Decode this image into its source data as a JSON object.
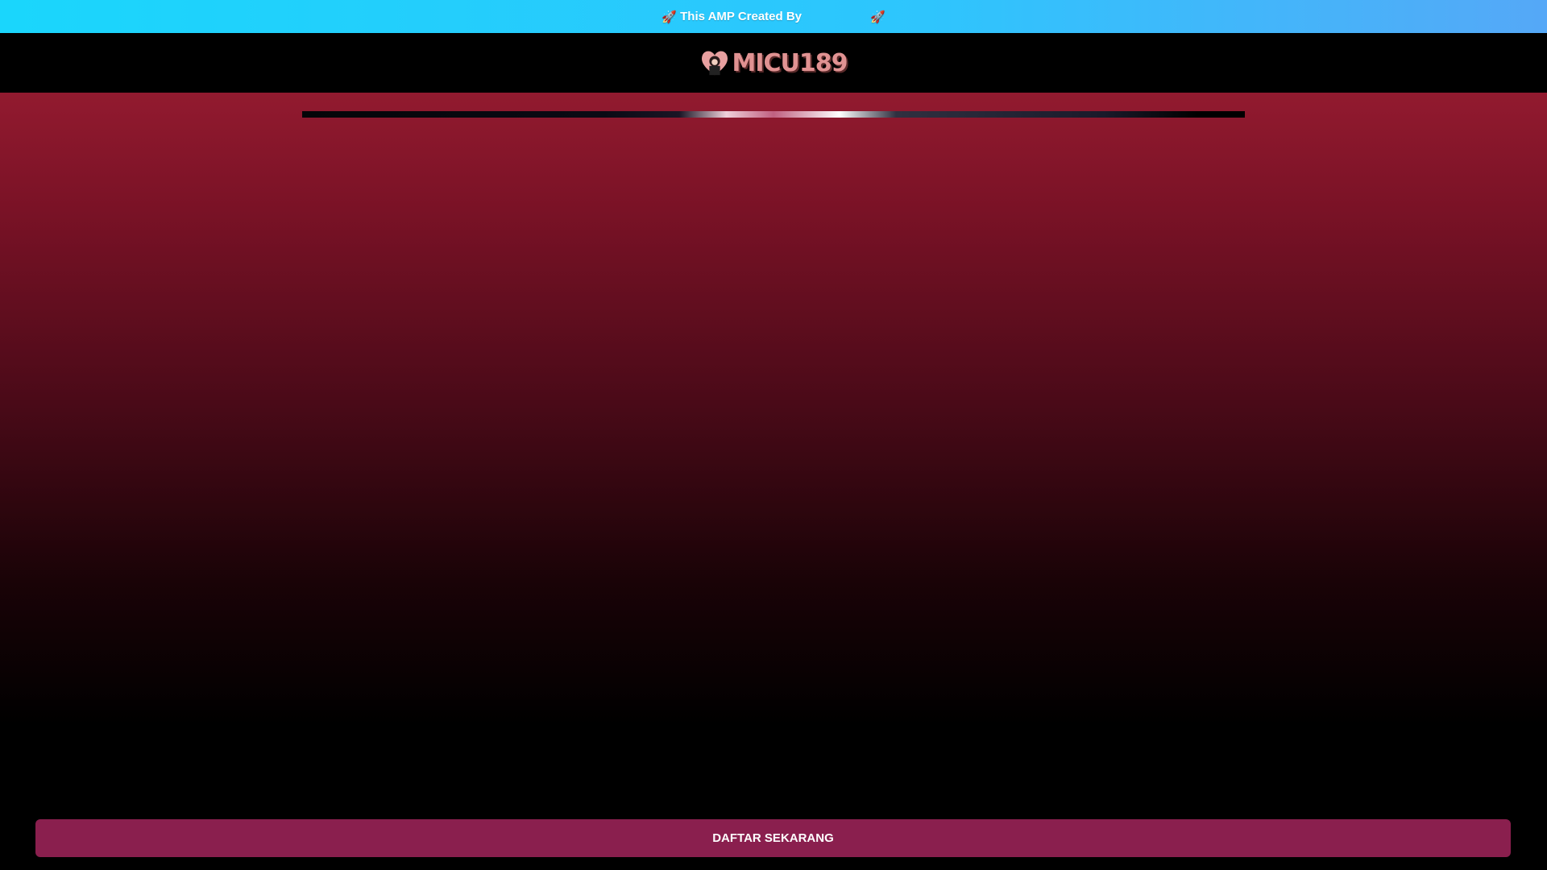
{
  "topbar": {
    "text": "This AMP Created By",
    "icon": "rocket-icon",
    "rocket": "🚀"
  },
  "header": {
    "logo_text": "MICU189"
  },
  "cta": {
    "label": "DAFTAR SEKARANG"
  },
  "colors": {
    "topbar": "#1ad6fc",
    "background": "#921a2f",
    "cta": "#8a1f4e",
    "logo": "#e09292"
  }
}
